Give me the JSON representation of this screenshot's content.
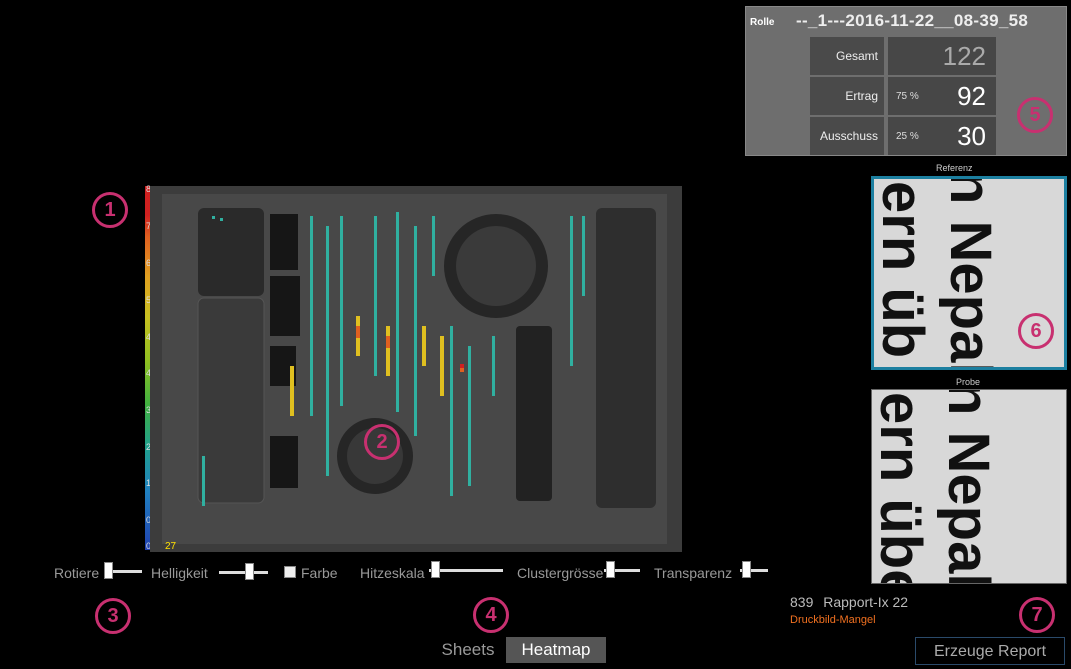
{
  "stats": {
    "rolle_label": "Rolle",
    "roll_id": "--_1---2016-11-22__08-39_58",
    "rows": [
      {
        "label": "Gesamt",
        "value": "122",
        "percent": ""
      },
      {
        "label": "Ertrag",
        "value": "92",
        "percent": "75 %"
      },
      {
        "label": "Ausschuss",
        "value": "30",
        "percent": "25 %"
      }
    ]
  },
  "scale": {
    "labels": [
      "8",
      "7",
      "6",
      "5",
      "4",
      "4",
      "3",
      "2",
      "1",
      "0",
      "0"
    ],
    "count": "27"
  },
  "reference": {
    "title": "Referenz",
    "lines": [
      "ern üb",
      "n Nepal"
    ]
  },
  "probe": {
    "title": "Probe",
    "lines": [
      "ern übe",
      "n Nepal"
    ]
  },
  "controls": {
    "rotiere": "Rotiere",
    "helligkeit": "Helligkeit",
    "farbe": "Farbe",
    "hitzeskala": "Hitzeskala",
    "clustergrosse": "Clustergrösse",
    "transparenz": "Transparenz"
  },
  "tabs": {
    "sheets": "Sheets",
    "heatmap": "Heatmap"
  },
  "rapport": {
    "number": "839",
    "label": "Rapport-Ix 22",
    "defect": "Druckbild-Mangel"
  },
  "report_button": "Erzeuge Report",
  "callouts": [
    "1",
    "2",
    "3",
    "4",
    "5",
    "6",
    "7"
  ],
  "colors": {
    "callout": "#c83070",
    "defect": "#f07020",
    "tab_active_bg": "#555555",
    "ref_border": "#1c7fa0"
  }
}
